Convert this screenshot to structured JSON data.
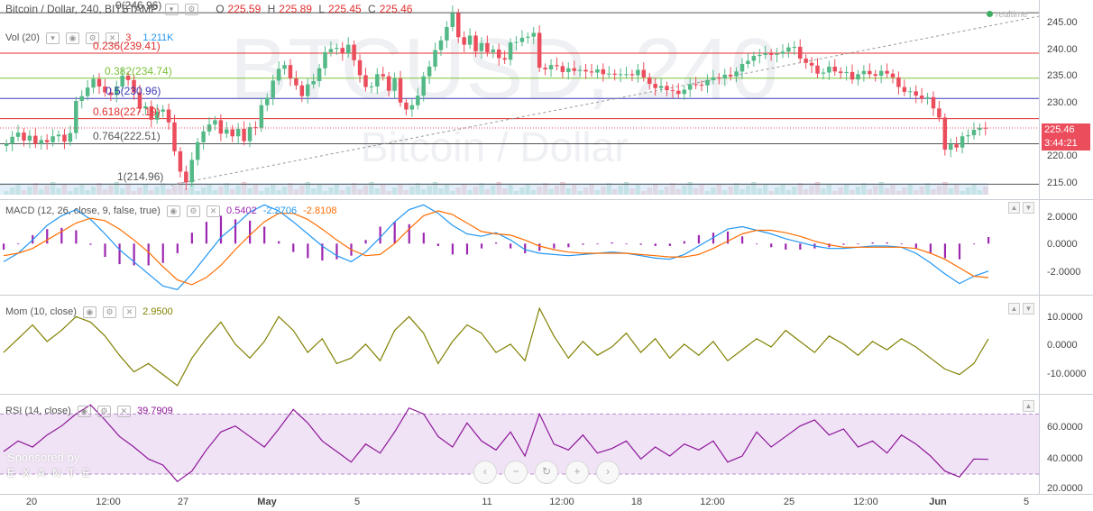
{
  "header": {
    "symbol": "Bitcoin / Dollar, 240, BITSTAMP",
    "open_lbl": "O",
    "open": "225.59",
    "high_lbl": "H",
    "high": "225.89",
    "low_lbl": "L",
    "low": "225.45",
    "close_lbl": "C",
    "close": "225.46",
    "realtime": "realtime"
  },
  "volume": {
    "label": "Vol (20)",
    "value1": "3",
    "value2": "1.211K"
  },
  "watermark": {
    "ticker": "BTCUSD, 240",
    "name": "Bitcoin / Dollar"
  },
  "price_axis": {
    "ticks": [
      "245.00",
      "240.00",
      "235.00",
      "230.00",
      "225.00",
      "220.00",
      "215.00"
    ],
    "last_price": "225.46",
    "countdown": "3:44:21"
  },
  "fib": [
    {
      "label": "0(246.96)",
      "value": 246.96,
      "color": "#555555"
    },
    {
      "label": "0.236(239.41)",
      "value": 239.41,
      "color": "#e0302e"
    },
    {
      "label": "0.382(234.74)",
      "value": 234.74,
      "color": "#7cc23a"
    },
    {
      "label": "0.5(230.96)",
      "value": 230.96,
      "color": "#3c3cb4"
    },
    {
      "label": "0.618(227.19)",
      "value": 227.19,
      "color": "#e0302e"
    },
    {
      "label": "0.764(222.51)",
      "value": 222.51,
      "color": "#555555"
    },
    {
      "label": "1(214.96)",
      "value": 214.96,
      "color": "#555555"
    }
  ],
  "macd": {
    "label": "MACD (12, 26, close, 9, false, true)",
    "v1": "0.5402",
    "v2": "-2.2706",
    "v3": "-2.8108",
    "ticks": [
      "2.0000",
      "0.0000",
      "-2.0000"
    ]
  },
  "mom": {
    "label": "Mom (10, close)",
    "value": "2.9500",
    "ticks": [
      "10.0000",
      "0.0000",
      "-10.0000"
    ]
  },
  "rsi": {
    "label": "RSI (14, close)",
    "value": "39.7909",
    "ticks": [
      "60.0000",
      "40.0000",
      "20.0000"
    ]
  },
  "sponsor": {
    "line1": "Sponsored by",
    "line2": "EXANTE"
  },
  "nav_icons": [
    "chevron-left-icon",
    "minus-icon",
    "reset-icon",
    "plus-icon",
    "chevron-right-icon"
  ],
  "time_axis": [
    "20",
    "12:00",
    "27",
    "May",
    "5",
    "11",
    "12:00",
    "18",
    "12:00",
    "25",
    "12:00",
    "Jun",
    "5"
  ],
  "colors": {
    "up": "#53b987",
    "down": "#eb4d5c",
    "macd": "#2196f3",
    "signal": "#ff6d00",
    "hist": "#9c27b0",
    "mom": "#808000",
    "rsi": "#8e1599",
    "rsi_band": "#f0e3f6"
  },
  "chart_data": [
    {
      "type": "candlestick",
      "title": "Bitcoin / Dollar, 240, BITSTAMP",
      "ylim": [
        213,
        248
      ],
      "close": [
        222.5,
        223.8,
        224.6,
        223.1,
        224.0,
        222.5,
        223.2,
        222.8,
        223.9,
        224.2,
        222.9,
        224.5,
        230.5,
        231.4,
        233.0,
        234.6,
        233.2,
        232.1,
        231.6,
        233.2,
        235.2,
        234.4,
        232.1,
        229.1,
        229.5,
        227.0,
        228.5,
        228.9,
        226.5,
        221.1,
        217.3,
        215.3,
        219.5,
        222.8,
        224.8,
        226.1,
        226.9,
        224.4,
        225.2,
        223.9,
        225.3,
        223.0,
        225.6,
        225.5,
        229.7,
        231.1,
        234.3,
        236.5,
        237.2,
        234.7,
        233.4,
        231.4,
        233.6,
        234.2,
        236.6,
        239.6,
        240.2,
        240.4,
        239.4,
        241.0,
        238.1,
        235.3,
        233.1,
        233.2,
        235.5,
        235.1,
        232.4,
        234.7,
        230.2,
        228.9,
        229.7,
        231.5,
        235.1,
        236.9,
        240.0,
        241.8,
        244.3,
        246.9,
        242.4,
        241.0,
        242.7,
        239.8,
        241.3,
        239.6,
        240.1,
        238.5,
        238.2,
        241.4,
        241.5,
        242.3,
        242.5,
        243.2,
        236.7,
        236.4,
        237.2,
        237.0,
        235.9,
        236.6,
        236.1,
        236.3,
        236.0,
        235.8,
        236.4,
        235.5,
        235.6,
        235.4,
        235.5,
        235.5,
        235.3,
        236.3,
        234.9,
        233.7,
        232.9,
        233.3,
        232.5,
        232.4,
        231.8,
        232.6,
        233.6,
        233.5,
        233.4,
        234.4,
        234.9,
        234.7,
        235.4,
        235.1,
        236.0,
        237.4,
        238.0,
        238.9,
        239.1,
        239.4,
        239.1,
        239.3,
        239.7,
        240.5,
        240.6,
        238.4,
        237.6,
        237.1,
        235.6,
        235.8,
        236.9,
        236.0,
        235.7,
        235.9,
        234.5,
        235.5,
        236.1,
        235.5,
        235.2,
        236.1,
        235.6,
        234.9,
        233.1,
        232.2,
        232.3,
        231.5,
        230.9,
        231.2,
        229.1,
        227.4,
        221.4,
        222.4,
        221.8,
        223.9,
        224.1,
        225.1,
        225.5,
        225.46
      ]
    },
    {
      "type": "line",
      "title": "MACD (12, 26, close, 9, false, true)",
      "series": [
        {
          "name": "MACD",
          "values": [
            -1.5,
            -0.8,
            0.3,
            1.5,
            2.3,
            2.8,
            2.0,
            0.8,
            -0.5,
            -1.5,
            -2.5,
            -3.5,
            -3.8,
            -2.5,
            -1.0,
            0.5,
            1.5,
            2.6,
            3.2,
            2.7,
            1.8,
            0.8,
            -0.2,
            -1.0,
            -1.5,
            -0.7,
            0.5,
            1.8,
            2.8,
            3.2,
            2.5,
            1.5,
            0.8,
            0.6,
            0.9,
            0.3,
            -0.5,
            -0.8,
            -0.9,
            -1.0,
            -0.9,
            -0.8,
            -0.7,
            -0.8,
            -1.0,
            -1.2,
            -1.3,
            -0.9,
            -0.2,
            0.5,
            1.2,
            1.4,
            1.1,
            0.8,
            0.4,
            0.1,
            -0.2,
            -0.4,
            -0.4,
            -0.3,
            -0.2,
            -0.2,
            -0.3,
            -0.8,
            -1.6,
            -2.5,
            -3.3,
            -2.7,
            -2.27
          ]
        },
        {
          "name": "Signal",
          "values": [
            -1.0,
            -0.8,
            -0.4,
            0.3,
            1.0,
            1.7,
            2.1,
            1.9,
            1.2,
            0.3,
            -0.7,
            -1.9,
            -3.0,
            -3.4,
            -2.8,
            -1.8,
            -0.5,
            0.7,
            1.8,
            2.5,
            2.5,
            2.0,
            1.2,
            0.3,
            -0.5,
            -1.0,
            -0.9,
            0.0,
            1.2,
            2.3,
            2.7,
            2.4,
            1.7,
            1.0,
            0.8,
            0.7,
            0.3,
            -0.2,
            -0.5,
            -0.7,
            -0.8,
            -0.8,
            -0.8,
            -0.8,
            -0.9,
            -1.0,
            -1.1,
            -1.1,
            -0.9,
            -0.4,
            0.2,
            0.8,
            1.1,
            1.1,
            0.9,
            0.6,
            0.2,
            -0.1,
            -0.3,
            -0.3,
            -0.3,
            -0.3,
            -0.3,
            -0.4,
            -0.8,
            -1.3,
            -2.0,
            -2.7,
            -2.81
          ]
        }
      ],
      "ylim": [
        -4,
        3
      ]
    },
    {
      "type": "line",
      "title": "Mom (10, close)",
      "series": [
        {
          "name": "Mom",
          "values": [
            -2,
            3,
            8,
            2,
            6,
            11,
            9,
            4,
            -3,
            -9,
            -6,
            -10,
            -14,
            -4,
            3,
            9,
            1,
            -4,
            2,
            11,
            6,
            -2,
            3,
            -6,
            -4,
            1,
            -5,
            6,
            11,
            5,
            -6,
            2,
            8,
            5,
            -2,
            1,
            -5,
            14,
            4,
            -4,
            2,
            -3,
            0,
            5,
            -2,
            3,
            -4,
            1,
            -3,
            2,
            -5,
            -1,
            3,
            0,
            6,
            2,
            -2,
            4,
            1,
            -3,
            2,
            -1,
            3,
            0,
            -4,
            -8,
            -10,
            -6,
            2.95
          ]
        }
      ],
      "ylim": [
        -16,
        16
      ]
    },
    {
      "type": "line",
      "title": "RSI (14, close)",
      "series": [
        {
          "name": "RSI",
          "values": [
            45,
            52,
            48,
            56,
            62,
            70,
            76,
            66,
            55,
            48,
            40,
            36,
            25,
            32,
            46,
            58,
            62,
            55,
            48,
            60,
            73,
            64,
            52,
            45,
            38,
            50,
            44,
            58,
            74,
            70,
            55,
            48,
            64,
            52,
            46,
            58,
            42,
            70,
            50,
            46,
            56,
            44,
            47,
            52,
            40,
            48,
            42,
            50,
            46,
            52,
            38,
            42,
            58,
            48,
            55,
            62,
            66,
            56,
            60,
            48,
            52,
            44,
            56,
            50,
            42,
            32,
            28,
            40,
            39.79
          ]
        }
      ],
      "ylim": [
        18,
        78
      ],
      "bands": [
        30,
        70
      ]
    }
  ]
}
